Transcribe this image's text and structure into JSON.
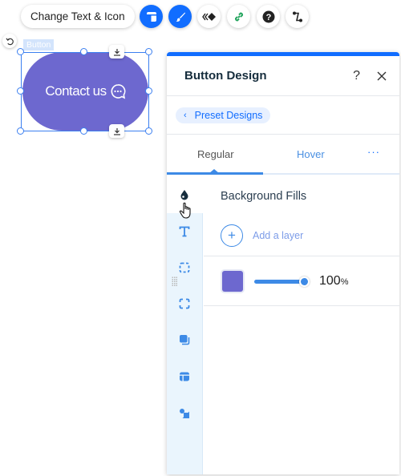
{
  "toolbar": {
    "change_text_label": "Change Text & Icon",
    "buttons": [
      {
        "name": "layout-button",
        "icon": "layout-icon",
        "active": true
      },
      {
        "name": "design-button",
        "icon": "brush-icon",
        "active": true
      },
      {
        "name": "animation-button",
        "icon": "animation-icon",
        "active": false
      },
      {
        "name": "link-button",
        "icon": "link-icon",
        "active": false
      },
      {
        "name": "help-button",
        "icon": "help-icon",
        "active": false
      },
      {
        "name": "connect-button",
        "icon": "connect-icon",
        "active": false
      }
    ]
  },
  "canvas": {
    "element_tag": "Button",
    "button_label": "Contact us",
    "button_icon": "chat-bubble-icon",
    "button_color": "#6d68cf"
  },
  "panel": {
    "title": "Button Design",
    "help_label": "?",
    "preset_label": "Preset Designs",
    "tabs": [
      {
        "label": "Regular",
        "selected": true
      },
      {
        "label": "Hover",
        "selected": false
      }
    ],
    "more_label": "···",
    "side_icons": [
      "fill-drop-icon",
      "text-icon",
      "border-icon",
      "corners-icon",
      "shadow-icon",
      "layout-icon",
      "icon-shapes-icon"
    ],
    "section_title": "Background Fills",
    "add_layer_label": "Add a layer",
    "layer": {
      "color": "#6d68cf",
      "opacity_value": "100",
      "opacity_unit": "%",
      "opacity_fraction": 1.0
    }
  },
  "colors": {
    "accent": "#116dff",
    "fill": "#6d68cf"
  }
}
